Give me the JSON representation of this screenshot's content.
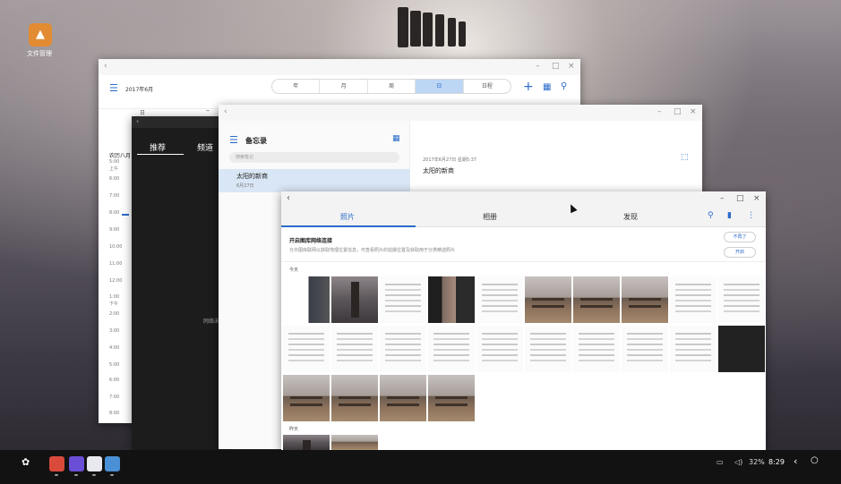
{
  "desktop": {
    "icon_label": "文件管理"
  },
  "calendar": {
    "title": "2017年6月",
    "views": [
      "年",
      "月",
      "周",
      "日",
      "日程"
    ],
    "active_view": "日",
    "col_letter": "日",
    "lunar_label": "农历八月",
    "times": [
      "5:00",
      "上午",
      "6:00",
      "7:00",
      "8:00",
      "9:00",
      "10:00",
      "11:00",
      "12:00",
      "1:00",
      "下午",
      "2:00",
      "3:00",
      "4:00",
      "5:00",
      "6:00",
      "7:00",
      "8:00"
    ]
  },
  "news": {
    "tabs": [
      "推荐",
      "频道"
    ],
    "body_text": "网络未"
  },
  "memo": {
    "title": "备忘录",
    "search_placeholder": "搜索笔记",
    "items": [
      {
        "title": "太阳的新商",
        "date": "6月27日"
      }
    ],
    "detail": {
      "meta": "2017年6月27日 星期5:37",
      "title": "太阳的新商"
    }
  },
  "gallery": {
    "tabs": [
      "照片",
      "相册",
      "发现"
    ],
    "active_tab": "照片",
    "banner_title": "开启图库网络连接",
    "banner_desc": "允许图库联网以获取地理位置信息，可查看照片的拍摄位置及获取用于分类精选照片",
    "btn_dismiss": "不再了",
    "btn_enable": "开启",
    "section_today": "今天",
    "section_yesterday": "昨天"
  },
  "taskbar": {
    "battery": "32%",
    "time": "8:29"
  }
}
